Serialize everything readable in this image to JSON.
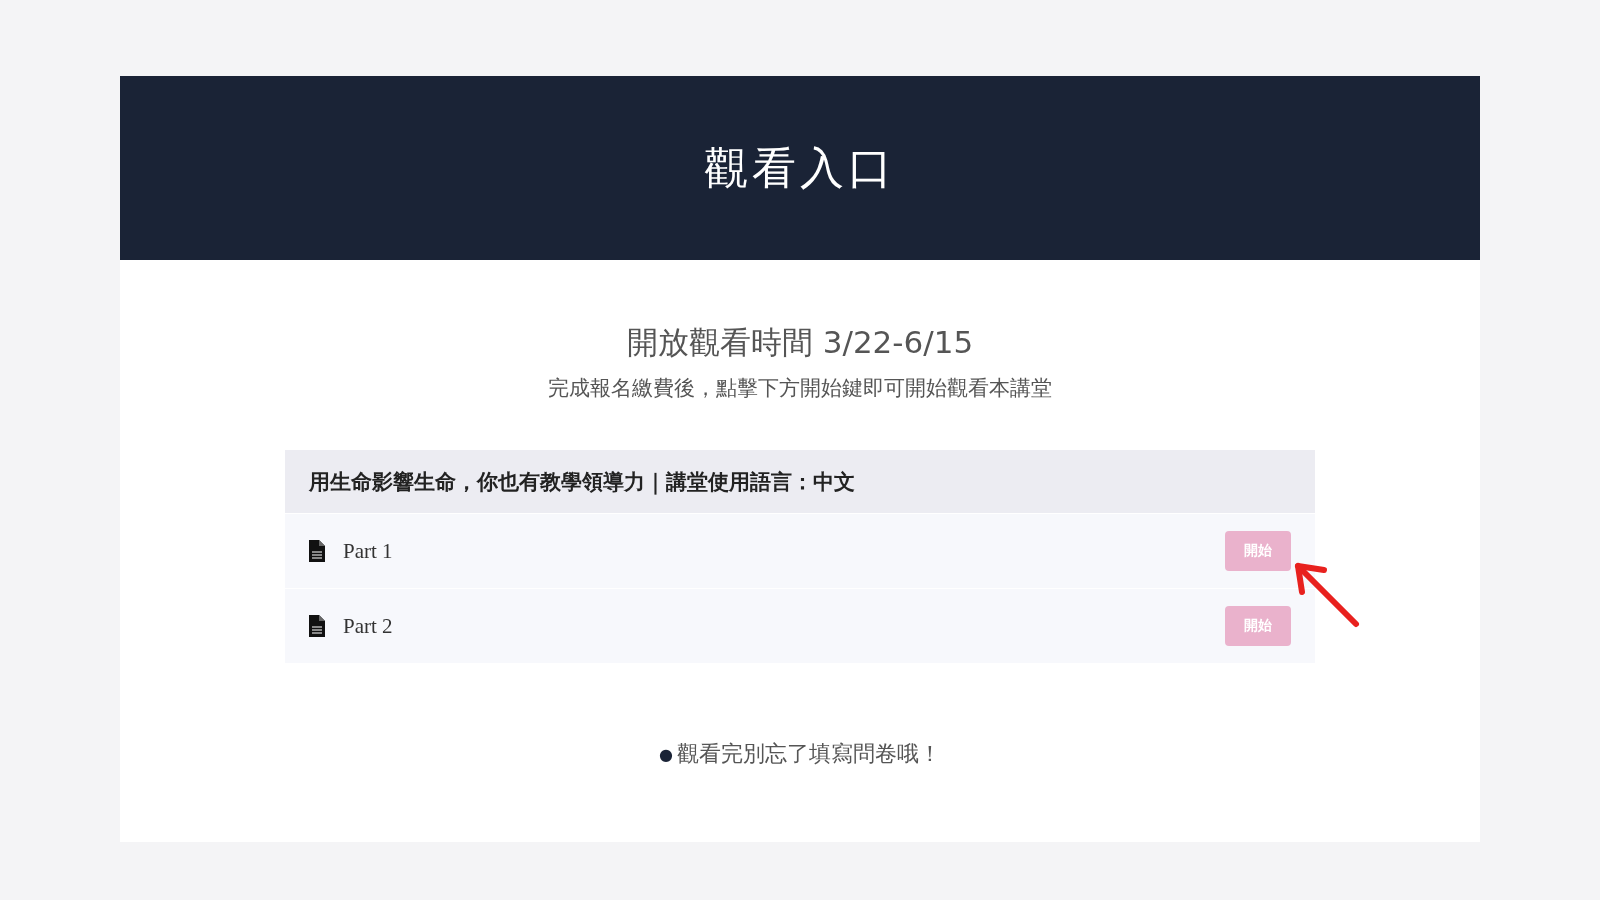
{
  "header": {
    "title": "觀看入口"
  },
  "period": {
    "title": "開放觀看時間 3/22-6/15",
    "subtitle": "完成報名繳費後，點擊下方開始鍵即可開始觀看本講堂"
  },
  "course": {
    "title": "用生命影響生命，你也有教學領導力｜講堂使用語言：中文",
    "parts": [
      {
        "label": "Part 1",
        "button": "開始",
        "disabled": true
      },
      {
        "label": "Part 2",
        "button": "開始",
        "disabled": true
      }
    ]
  },
  "note": {
    "bullet": "●",
    "text": "觀看完別忘了填寫問卷哦！"
  }
}
